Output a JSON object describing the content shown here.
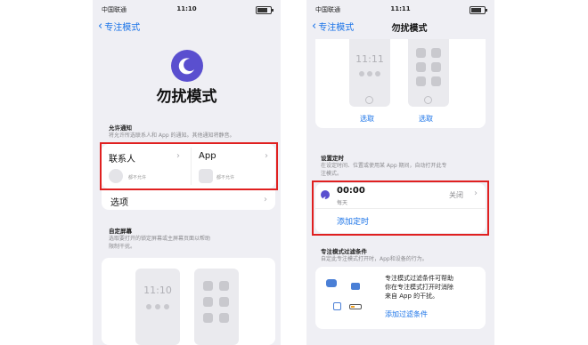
{
  "left": {
    "status": {
      "carrier": "中国联通",
      "time": "11:10"
    },
    "nav": {
      "back_label": "专注模式"
    },
    "page_title": "勿扰模式",
    "allow_section": {
      "header": "允许通知",
      "desc": "将允许所选联系人和 App 的通知。其他通知将静音。",
      "contacts": {
        "label": "联系人",
        "sub": "都不允许"
      },
      "apps": {
        "label": "App",
        "sub": "都不允许"
      }
    },
    "options_label": "选项",
    "custom_screen": {
      "header": "自定屏幕",
      "desc_line1": "选取要打开的锁定屏幕或主屏幕页面以帮助",
      "desc_line2": "限制干扰。",
      "mock_clock": "11:10"
    }
  },
  "right": {
    "status": {
      "carrier": "中国联通",
      "time": "11:11"
    },
    "nav": {
      "back_label": "专注模式",
      "title": "勿扰模式"
    },
    "mock_clock": "11:11",
    "choose_left": "选取",
    "choose_right": "选取",
    "schedule": {
      "header": "设置定时",
      "desc_line1": "在设定时间、位置或使用某 App 期间，自动打开此专",
      "desc_line2": "注模式。",
      "time": "00:00",
      "repeat": "每天",
      "state": "关闭",
      "add_label": "添加定时"
    },
    "filters": {
      "header": "专注模式过滤条件",
      "desc": "自定此专注模式打开时，App和设备的行为。",
      "body_line1": "专注模式过滤条件可帮助",
      "body_line2": "你在专注模式打开时消除",
      "body_line3": "来自 App 的干扰。",
      "add_label": "添加过滤条件"
    }
  },
  "colors": {
    "accent": "#1a73e8",
    "highlight": "#e02020",
    "moon": "#5a4fcf"
  }
}
